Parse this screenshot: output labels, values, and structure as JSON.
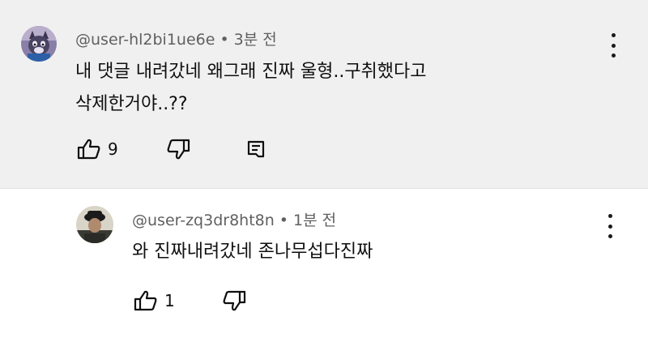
{
  "comments": [
    {
      "username": "@user-hl2bi1ue6e",
      "separator": "•",
      "time": "3분 전",
      "text_lines": [
        "내 댓글 내려갔네 왜그래 진짜 울형..구취했다고",
        "삭제한거야..??"
      ],
      "like_count": "9",
      "avatar_icon": "cat-avatar-icon"
    },
    {
      "username": "@user-zq3dr8ht8n",
      "separator": "•",
      "time": "1분 전",
      "text_lines": [
        "와 진짜내려갔네 존나무섭다진짜"
      ],
      "like_count": "1",
      "avatar_icon": "person-avatar-icon"
    }
  ],
  "colors": {
    "top_background": "#f0f0f0",
    "meta_text": "#606060",
    "body_text": "#0f0f0f"
  }
}
